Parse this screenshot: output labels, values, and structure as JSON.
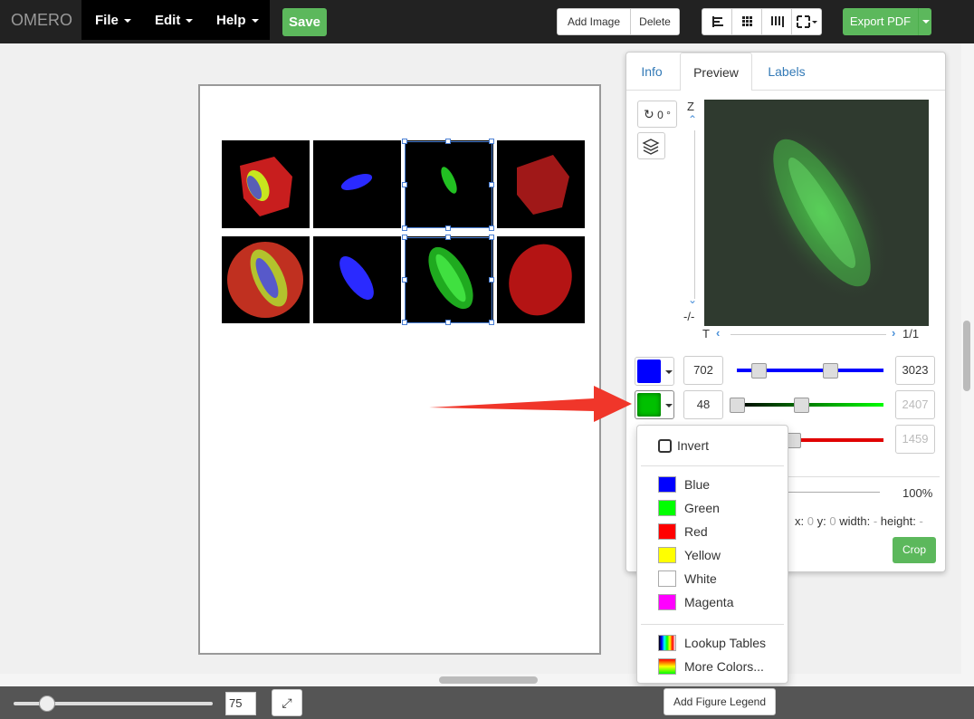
{
  "app": {
    "brand": "OMERO"
  },
  "menu": {
    "file": "File",
    "edit": "Edit",
    "help": "Help"
  },
  "toolbar": {
    "save": "Save",
    "add_image": "Add Image",
    "delete": "Delete",
    "export_pdf": "Export PDF"
  },
  "tabs": {
    "info": "Info",
    "preview": "Preview",
    "labels": "Labels"
  },
  "preview": {
    "rotation": "0 °",
    "z_label": "Z",
    "z_value": "-/-",
    "t_label": "T",
    "t_value": "1/1"
  },
  "channels": [
    {
      "start": "702",
      "end": "3023",
      "color": "#0000ff"
    },
    {
      "start": "48",
      "end": "2407",
      "color": "#00ff00"
    },
    {
      "start": "",
      "end": "1459",
      "color": "#ff0000"
    }
  ],
  "zoom": {
    "percent": "100%"
  },
  "crop": {
    "x_label": "x:",
    "x": "0",
    "y_label": "y:",
    "y": "0",
    "width_label": "width:",
    "width": "-",
    "height_label": "height:",
    "height": "-",
    "button": "Crop"
  },
  "color_menu": {
    "invert": "Invert",
    "colors": [
      {
        "label": "Blue",
        "hex": "#0000ff"
      },
      {
        "label": "Green",
        "hex": "#00ff00"
      },
      {
        "label": "Red",
        "hex": "#ff0000"
      },
      {
        "label": "Yellow",
        "hex": "#ffff00"
      },
      {
        "label": "White",
        "hex": "#ffffff"
      },
      {
        "label": "Magenta",
        "hex": "#ff00ff"
      }
    ],
    "lookup_tables": "Lookup Tables",
    "more_colors": "More Colors..."
  },
  "bottom": {
    "zoom_value": "75",
    "add_legend": "Add Figure Legend"
  }
}
